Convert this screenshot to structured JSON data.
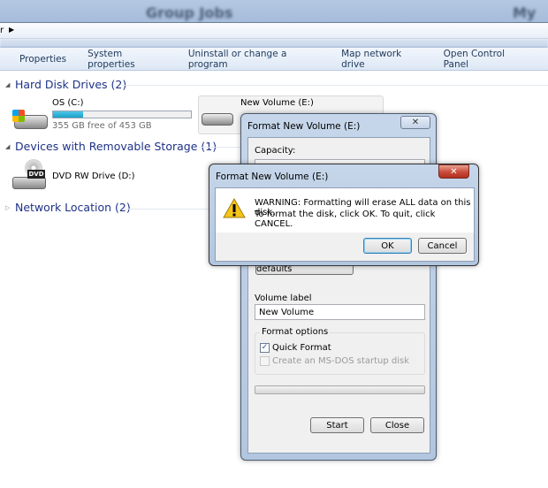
{
  "window": {
    "title_blurred": "Group Jobs",
    "title_blurred_right": "My C"
  },
  "address": {
    "text": "r"
  },
  "commands": [
    "Properties",
    "System properties",
    "Uninstall or change a program",
    "Map network drive",
    "Open Control Panel"
  ],
  "groups": {
    "hard_disks": {
      "label": "Hard Disk Drives (2)",
      "drives": [
        {
          "name": "OS (C:)",
          "free": "355 GB free of 453 GB",
          "used_fraction": 0.22
        },
        {
          "name": "New Volume (E:)"
        }
      ]
    },
    "removable": {
      "label": "Devices with Removable Storage (1)",
      "drives": [
        {
          "name": "DVD RW Drive (D:)",
          "badge": "DVD"
        }
      ]
    },
    "network": {
      "label": "Network Location (2)"
    }
  },
  "format_dialog": {
    "title": "Format New Volume (E:)",
    "capacity_label": "Capacity:",
    "restore_button": "Restore device defaults",
    "volume_label": "Volume label",
    "volume_value": "New Volume",
    "options_label": "Format options",
    "quick_format": {
      "label": "Quick Format",
      "checked": true
    },
    "msdos": {
      "label": "Create an MS-DOS startup disk",
      "checked": false,
      "enabled": false
    },
    "progress": 0,
    "start": "Start",
    "close": "Close"
  },
  "warning_dialog": {
    "title": "Format New Volume (E:)",
    "line1": "WARNING: Formatting will erase ALL data on this disk.",
    "line2": "To format the disk, click OK. To quit, click CANCEL.",
    "ok": "OK",
    "cancel": "Cancel",
    "accent": "#c94b3a"
  }
}
